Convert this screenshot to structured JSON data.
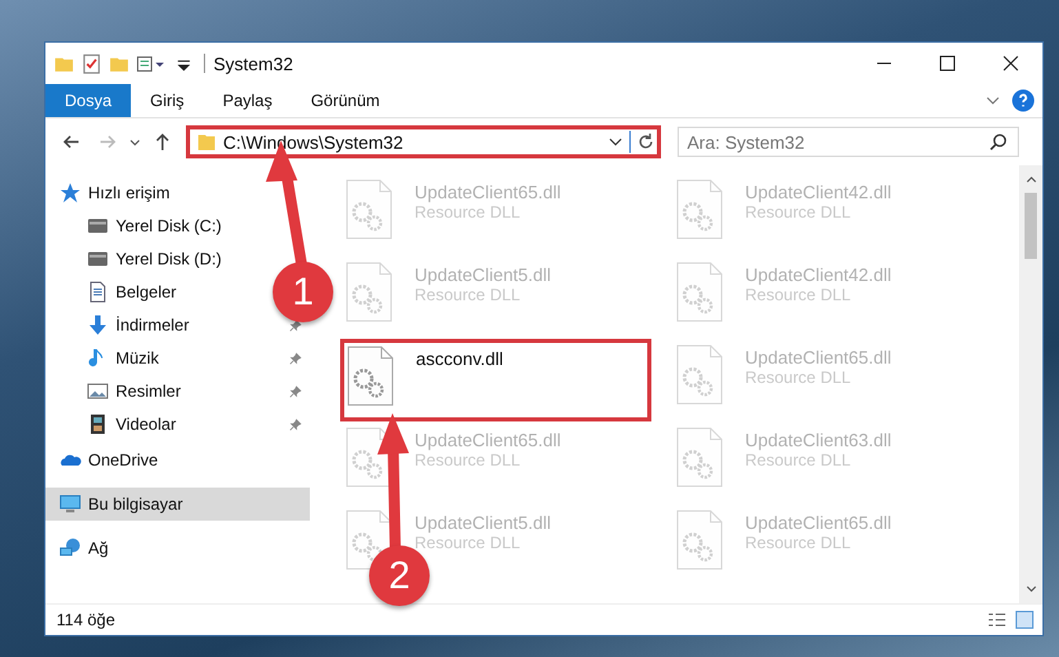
{
  "window": {
    "title": "System32"
  },
  "ribbon_tabs": [
    {
      "label": "Dosya",
      "selected": true
    },
    {
      "label": "Giriş",
      "selected": false
    },
    {
      "label": "Paylaş",
      "selected": false
    },
    {
      "label": "Görünüm",
      "selected": false
    }
  ],
  "address_bar": {
    "path": "C:\\Windows\\System32",
    "highlighted": true
  },
  "search": {
    "placeholder": "Ara: System32"
  },
  "sidebar": {
    "items": [
      {
        "label": "Hızlı erişim",
        "kind": "star",
        "selected": false,
        "children": [
          {
            "label": "Yerel Disk (C:)",
            "kind": "drive",
            "selected": false
          },
          {
            "label": "Yerel Disk (D:)",
            "kind": "drive",
            "selected": false
          },
          {
            "label": "Belgeler",
            "kind": "document",
            "selected": false
          },
          {
            "label": "İndirmeler",
            "kind": "download",
            "pinned": true,
            "selected": false
          },
          {
            "label": "Müzik",
            "kind": "music",
            "pinned": true,
            "selected": false
          },
          {
            "label": "Resimler",
            "kind": "picture",
            "pinned": true,
            "selected": false
          },
          {
            "label": "Videolar",
            "kind": "video",
            "pinned": true,
            "selected": false
          }
        ]
      },
      {
        "label": "OneDrive",
        "kind": "cloud",
        "selected": false
      },
      {
        "label": "Bu bilgisayar",
        "kind": "computer",
        "selected": true
      },
      {
        "label": "Ağ",
        "kind": "network",
        "selected": false
      }
    ]
  },
  "files": [
    {
      "name": "UpdateClient65.dll",
      "type": "Resource DLL",
      "dimmed": true,
      "highlighted": false
    },
    {
      "name": "UpdateClient42.dll",
      "type": "Resource DLL",
      "dimmed": true,
      "highlighted": false
    },
    {
      "name": "UpdateClient5.dll",
      "type": "Resource DLL",
      "dimmed": true,
      "highlighted": false
    },
    {
      "name": "UpdateClient42.dll",
      "type": "Resource DLL",
      "dimmed": true,
      "highlighted": false
    },
    {
      "name": "ascconv.dll",
      "dimmed": false,
      "highlighted": true
    },
    {
      "name": "UpdateClient65.dll",
      "type": "Resource DLL",
      "dimmed": true,
      "highlighted": false
    },
    {
      "name": "UpdateClient65.dll",
      "type": "Resource DLL",
      "dimmed": true,
      "highlighted": false
    },
    {
      "name": "UpdateClient63.dll",
      "type": "Resource DLL",
      "dimmed": true,
      "highlighted": false
    },
    {
      "name": "UpdateClient5.dll",
      "type": "Resource DLL",
      "dimmed": true,
      "highlighted": false
    },
    {
      "name": "UpdateClient65.dll",
      "type": "Resource DLL",
      "dimmed": true,
      "highlighted": false
    }
  ],
  "annotations": [
    {
      "label": "1"
    },
    {
      "label": "2"
    }
  ],
  "status_bar": {
    "item_count": "114 öğe"
  }
}
